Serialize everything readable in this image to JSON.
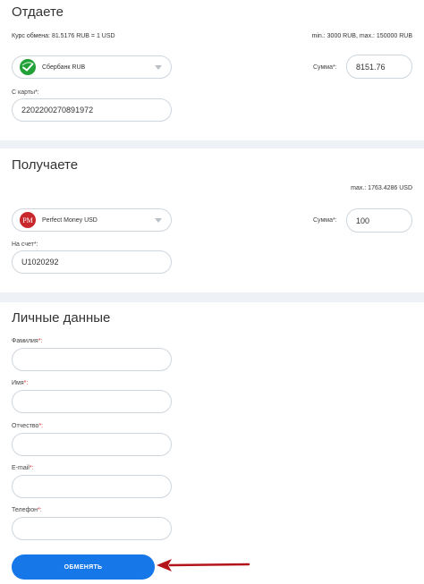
{
  "give": {
    "title": "Отдаете",
    "rate": "Курс обмена: 81.5176 RUB = 1 USD",
    "limits": "min.: 3000 RUB, max.: 150000 RUB",
    "currency": "Сбербанк RUB",
    "amount_label": "Сумма*:",
    "amount_value": "8151.76",
    "card_label": "С карты*:",
    "card_value": "2202200270891972"
  },
  "receive": {
    "title": "Получаете",
    "limits": "max.: 1763.4286 USD",
    "currency": "Perfect Money USD",
    "amount_label": "Сумма*:",
    "amount_value": "100",
    "account_label": "На счет*:",
    "account_value": "U1020292"
  },
  "personal": {
    "title": "Личные данные",
    "surname_label": "Фамилия",
    "name_label": "Имя",
    "patronymic_label": "Отчество",
    "email_label": "E-mail",
    "phone_label": "Телефон",
    "required_mark": "*:"
  },
  "exchange_button": "ОБМЕНЯТЬ",
  "icons": {
    "sber": "sberbank-logo-icon",
    "pm": "perfect-money-logo-icon",
    "arrow": "annotation-arrow-icon"
  },
  "colors": {
    "button": "#1577e8",
    "sber_green": "#21a038",
    "pm_red": "#c8272c",
    "arrow_red": "#b3141a"
  }
}
